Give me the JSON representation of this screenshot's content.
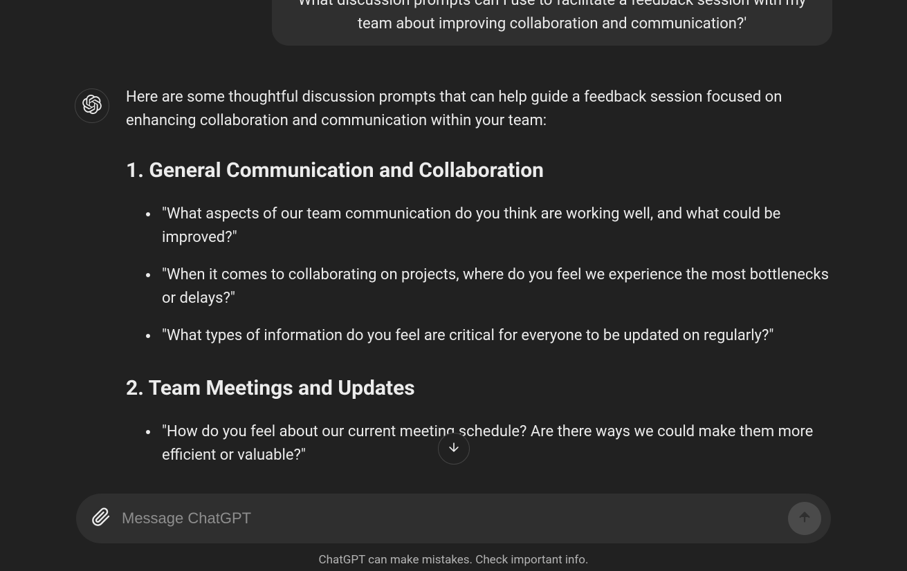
{
  "user_message": "What discussion prompts can I use to facilitate a feedback session with my team about improving collaboration and communication?'",
  "assistant": {
    "intro": "Here are some thoughtful discussion prompts that can help guide a feedback session focused on enhancing collaboration and communication within your team:",
    "sections": [
      {
        "number": "1. ",
        "title": "General Communication and Collaboration",
        "items": [
          "\"What aspects of our team communication do you think are working well, and what could be improved?\"",
          "\"When it comes to collaborating on projects, where do you feel we experience the most bottlenecks or delays?\"",
          "\"What types of information do you feel are critical for everyone to be updated on regularly?\""
        ]
      },
      {
        "number": "2. ",
        "title": "Team Meetings and Updates",
        "items": [
          "\"How do you feel about our current meeting schedule? Are there ways we could make them more efficient or valuable?\""
        ]
      }
    ]
  },
  "input": {
    "placeholder": "Message ChatGPT"
  },
  "disclaimer": "ChatGPT can make mistakes. Check important info."
}
